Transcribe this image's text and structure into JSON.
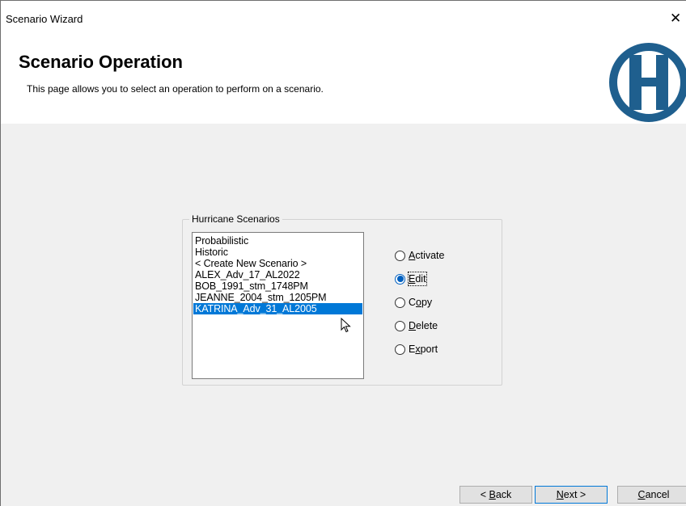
{
  "window": {
    "title": "Scenario Wizard",
    "close_glyph": "✕"
  },
  "header": {
    "title": "Scenario Operation",
    "description": "This page allows you to select an operation to perform on a scenario.",
    "logo_icon": "hazus-h-logo",
    "logo_color": "#1f5f8e"
  },
  "scenarios": {
    "label": "Hurricane Scenarios",
    "items": [
      "Probabilistic",
      "Historic",
      "< Create New Scenario >",
      "ALEX_Adv_17_AL2022",
      "BOB_1991_stm_1748PM",
      "JEANNE_2004_stm_1205PM",
      "KATRINA_Adv_31_AL2005"
    ],
    "selected": "KATRINA_Adv_31_AL2005"
  },
  "operations": {
    "activate": {
      "key": "A",
      "rest": "ctivate"
    },
    "edit": {
      "key": "E",
      "rest": "dit"
    },
    "copy": {
      "pre": "C",
      "key": "o",
      "rest": "py"
    },
    "delete": {
      "key": "D",
      "rest": "elete"
    },
    "export": {
      "pre": "E",
      "key": "x",
      "rest": "port"
    },
    "selected": "Edit"
  },
  "buttons": {
    "back": {
      "pre": "< ",
      "key": "B",
      "rest": "ack"
    },
    "next": {
      "key": "N",
      "rest": "ext >"
    },
    "cancel": {
      "key": "C",
      "rest": "ancel"
    }
  },
  "colors": {
    "selection": "#0078d7",
    "accent": "#0060c0"
  }
}
